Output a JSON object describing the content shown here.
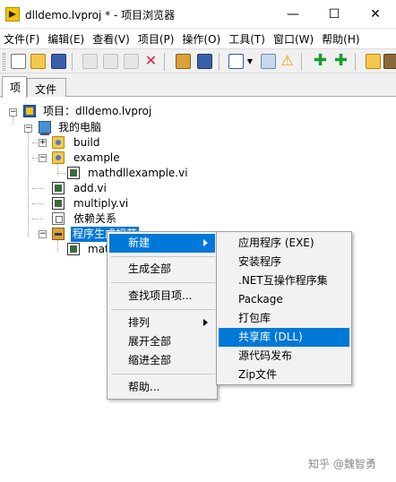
{
  "window": {
    "title": "dlldemo.lvproj * - 项目浏览器",
    "controls": {
      "minimize": "—",
      "maximize": "☐",
      "close": "✕"
    }
  },
  "menubar": [
    "文件(F)",
    "编辑(E)",
    "查看(V)",
    "项目(P)",
    "操作(O)",
    "工具(T)",
    "窗口(W)",
    "帮助(H)"
  ],
  "toolbar_icons": [
    "new-icon",
    "open-icon",
    "save-all-icon",
    "cut-icon",
    "copy-icon",
    "paste-icon",
    "delete-icon",
    "build-icon",
    "save-icon",
    "view-icon",
    "chevron-down-icon",
    "properties-icon",
    "warning-icon",
    "add-icon",
    "add-file-icon",
    "library-icon"
  ],
  "tabs": [
    "项",
    "文件"
  ],
  "tree": {
    "project": "项目：dlldemo.lvproj",
    "computer": "我的电脑",
    "build": "build",
    "example": "example",
    "example_child": "mathdllexample.vi",
    "add": "add.vi",
    "multiply": "multiply.vi",
    "dependencies": "依赖关系",
    "build_specs": "程序生成规范",
    "build_child": "mat"
  },
  "context_menu": {
    "items": [
      "新建",
      "生成全部",
      "查找项目项...",
      "排列",
      "展开全部",
      "缩进全部",
      "帮助..."
    ]
  },
  "submenu": {
    "items": [
      "应用程序 (EXE)",
      "安装程序",
      ".NET互操作程序集",
      "Package",
      "打包库",
      "共享库 (DLL)",
      "源代码发布",
      "Zip文件"
    ],
    "highlighted": "共享库 (DLL)"
  },
  "watermark": "知乎 @魏智勇",
  "colors": {
    "highlight": "#0078d7",
    "menu_bg": "#f2f2f2"
  }
}
